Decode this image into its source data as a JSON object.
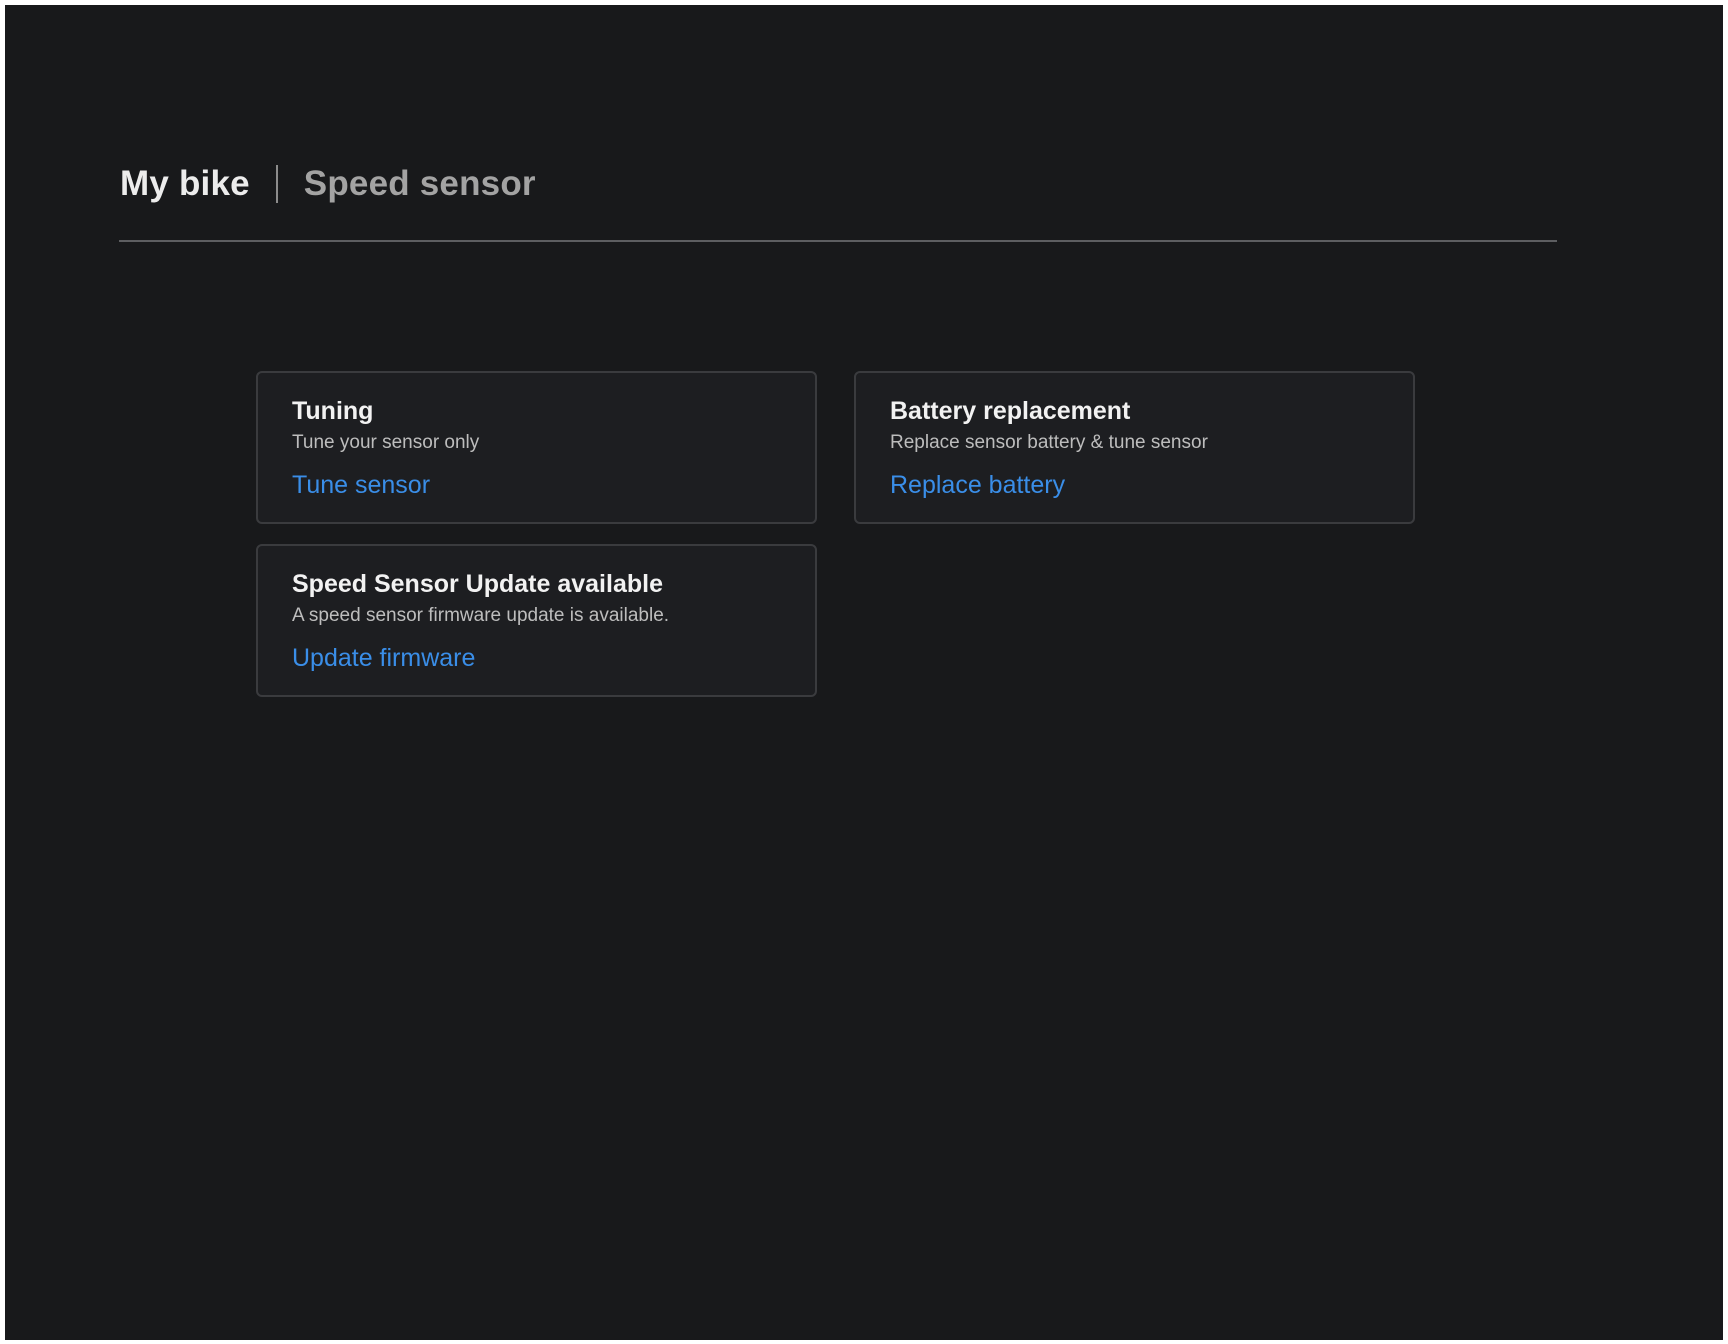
{
  "header": {
    "primary": "My bike",
    "secondary": "Speed sensor"
  },
  "cards": [
    {
      "title": "Tuning",
      "description": "Tune your sensor only",
      "link": "Tune sensor"
    },
    {
      "title": "Battery replacement",
      "description": "Replace sensor battery & tune sensor",
      "link": "Replace battery"
    },
    {
      "title": "Speed Sensor Update available",
      "description": "A speed sensor firmware update is available.",
      "link": "Update firmware"
    }
  ],
  "colors": {
    "background": "#18191b",
    "card_background": "#1d1e21",
    "card_border": "#3a3b3e",
    "link": "#3a8ee8",
    "title_text": "#f2f2f2",
    "secondary_text": "#bdbdbd"
  }
}
